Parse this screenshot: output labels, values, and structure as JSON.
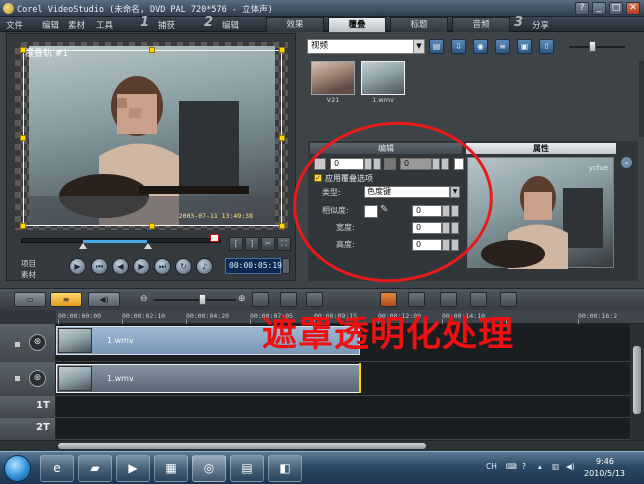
{
  "window": {
    "title": "Corel VideoStudio (未命名, DVD PAL 720*576 - 立体声)",
    "help": "?",
    "minimize": "_",
    "maximize": "□",
    "close": "✕"
  },
  "menu": [
    "文件",
    "编辑",
    "素材",
    "工具"
  ],
  "steps": [
    {
      "num": "1",
      "label": "捕获"
    },
    {
      "num": "2",
      "label": "编辑"
    },
    {
      "num": "3",
      "label": "分享"
    }
  ],
  "subtabs": [
    {
      "label": "效果",
      "active": false
    },
    {
      "label": "覆叠",
      "active": true
    },
    {
      "label": "标题",
      "active": false
    },
    {
      "label": "音频",
      "active": false
    }
  ],
  "player": {
    "track_label": "覆叠轨 #1",
    "video_timestamp": "2003-07-11 13:49:38",
    "mode_project": "项目",
    "mode_clip": "素材",
    "timecode": "00:00:05:19"
  },
  "library": {
    "category": "视频",
    "thumbnails": [
      {
        "label": "V21"
      },
      {
        "label": "1.wmv"
      }
    ]
  },
  "options": {
    "edit_header": "编辑",
    "attr_header": "属性",
    "rotation_value": "0",
    "fade_value": "0",
    "overlay_option_label": "应用覆叠选项",
    "type_label": "类型:",
    "type_value": "色度键",
    "similarity_label": "相似度:",
    "similarity_value": "0",
    "width_label": "宽度:",
    "width_value": "0",
    "height_label": "高度:",
    "height_value": "0"
  },
  "timeline": {
    "ruler": [
      "00:00:00:00",
      "00:00:02:10",
      "00:00:04:20",
      "00:00:07:05",
      "00:00:09:15",
      "00:00:12:00",
      "00:00:14:10",
      "00:00:16:2"
    ],
    "clips": [
      {
        "name": "1.wmv"
      },
      {
        "name": "1.wmv"
      }
    ],
    "title_tracks": [
      "1T",
      "2T"
    ]
  },
  "taskbar": {
    "lang": "CH",
    "time": "9:46",
    "date": "2010/5/13"
  },
  "annotation": "遮罩透明化处理",
  "colors": {
    "annotation": "#ee1111",
    "accent": "#ffd800",
    "selected_tab": "#d9dee3"
  }
}
